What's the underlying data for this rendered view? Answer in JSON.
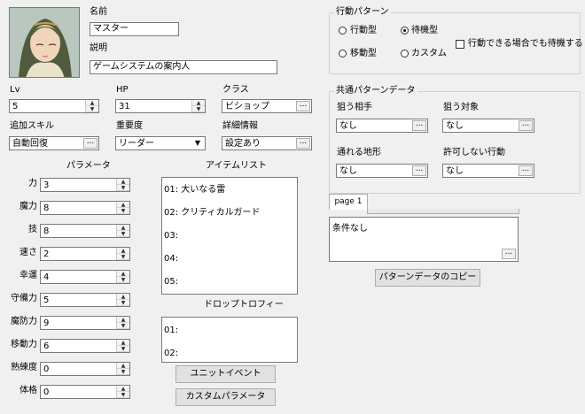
{
  "character": {
    "name_label": "名前",
    "name_value": "マスター",
    "desc_label": "説明",
    "desc_value": "ゲームシステムの案内人"
  },
  "stats": {
    "lv_label": "Lv",
    "lv_value": "5",
    "hp_label": "HP",
    "hp_value": "31",
    "class_label": "クラス",
    "class_value": "ビショップ",
    "skill_label": "追加スキル",
    "skill_value": "自動回復",
    "importance_label": "重要度",
    "importance_value": "リーダー",
    "detail_label": "詳細情報",
    "detail_value": "設定あり"
  },
  "params": {
    "title": "パラメータ",
    "rows": [
      {
        "label": "力",
        "value": "3"
      },
      {
        "label": "魔力",
        "value": "8"
      },
      {
        "label": "技",
        "value": "8"
      },
      {
        "label": "速さ",
        "value": "2"
      },
      {
        "label": "幸運",
        "value": "4"
      },
      {
        "label": "守備力",
        "value": "5"
      },
      {
        "label": "魔防力",
        "value": "9"
      },
      {
        "label": "移動力",
        "value": "6"
      },
      {
        "label": "熟練度",
        "value": "0"
      },
      {
        "label": "体格",
        "value": "0"
      }
    ]
  },
  "items": {
    "title": "アイテムリスト",
    "rows": [
      "01:  大いなる雷",
      "02:  クリティカルガード",
      "03:",
      "04:",
      "05:"
    ]
  },
  "drops": {
    "title": "ドロップトロフィー",
    "rows": [
      "01:",
      "02:"
    ]
  },
  "buttons": {
    "unit_event": "ユニットイベント",
    "custom_param": "カスタムパラメータ",
    "copy_pattern": "パターンデータのコピー"
  },
  "action_pattern": {
    "title": "行動パターン",
    "options": [
      "行動型",
      "待機型",
      "移動型",
      "カスタム"
    ],
    "selected": "待機型",
    "checkbox_label": "行動できる場合でも待機する"
  },
  "common_pattern": {
    "title": "共通パターンデータ",
    "target_label": "狙う相手",
    "target_value": "なし",
    "object_label": "狙う対象",
    "object_value": "なし",
    "terrain_label": "通れる地形",
    "terrain_value": "なし",
    "forbid_label": "許可しない行動",
    "forbid_value": "なし"
  },
  "page_tab": {
    "label": "page 1"
  },
  "condition": {
    "value": "条件なし"
  }
}
